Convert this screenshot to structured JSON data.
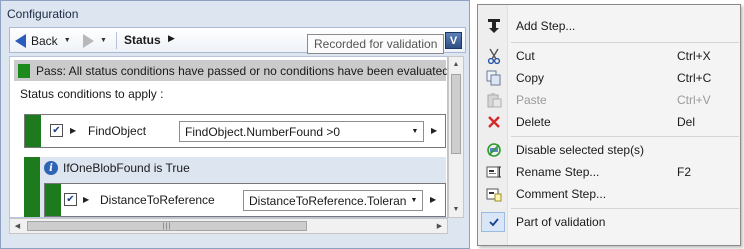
{
  "panel": {
    "title": "Configuration",
    "toolbar": {
      "back_label": "Back",
      "breadcrumb": "Status",
      "validation_button_label": "V",
      "tooltip": "Recorded for validation"
    },
    "status_message": "Pass: All status conditions have passed or no conditions have been evaluated",
    "section_label": "Status conditions to apply :",
    "rows": [
      {
        "name": "FindObject",
        "expression": "FindObject.NumberFound >0",
        "checked": true
      },
      {
        "name": "DistanceToReference",
        "expression": "DistanceToReference.Toleran",
        "checked": true
      }
    ],
    "group": {
      "title": "IfOneBlobFound is True"
    },
    "scrollbar_grip": "|||"
  },
  "menu": {
    "items": [
      {
        "label": "Add Step...",
        "shortcut": "",
        "icon": "pin-icon",
        "enabled": true
      },
      {
        "label": "Cut",
        "shortcut": "Ctrl+X",
        "icon": "scissors-icon",
        "enabled": true
      },
      {
        "label": "Copy",
        "shortcut": "Ctrl+C",
        "icon": "copy-icon",
        "enabled": true
      },
      {
        "label": "Paste",
        "shortcut": "Ctrl+V",
        "icon": "paste-icon",
        "enabled": false
      },
      {
        "label": "Delete",
        "shortcut": "Del",
        "icon": "delete-x-icon",
        "enabled": true
      },
      {
        "label": "Disable selected step(s)",
        "shortcut": "",
        "icon": "disable-step-icon",
        "enabled": true
      },
      {
        "label": "Rename Step...",
        "shortcut": "F2",
        "icon": "rename-step-icon",
        "enabled": true
      },
      {
        "label": "Comment Step...",
        "shortcut": "",
        "icon": "comment-step-icon",
        "enabled": true
      },
      {
        "label": "Part of validation",
        "shortcut": "",
        "icon": "checkmark-icon",
        "enabled": true,
        "checked": true
      }
    ]
  },
  "colors": {
    "pass_green": "#1d8a1d",
    "delete_red": "#d42a2a",
    "accent_blue": "#2f63b6",
    "panel_bg": "#dde5f0"
  }
}
